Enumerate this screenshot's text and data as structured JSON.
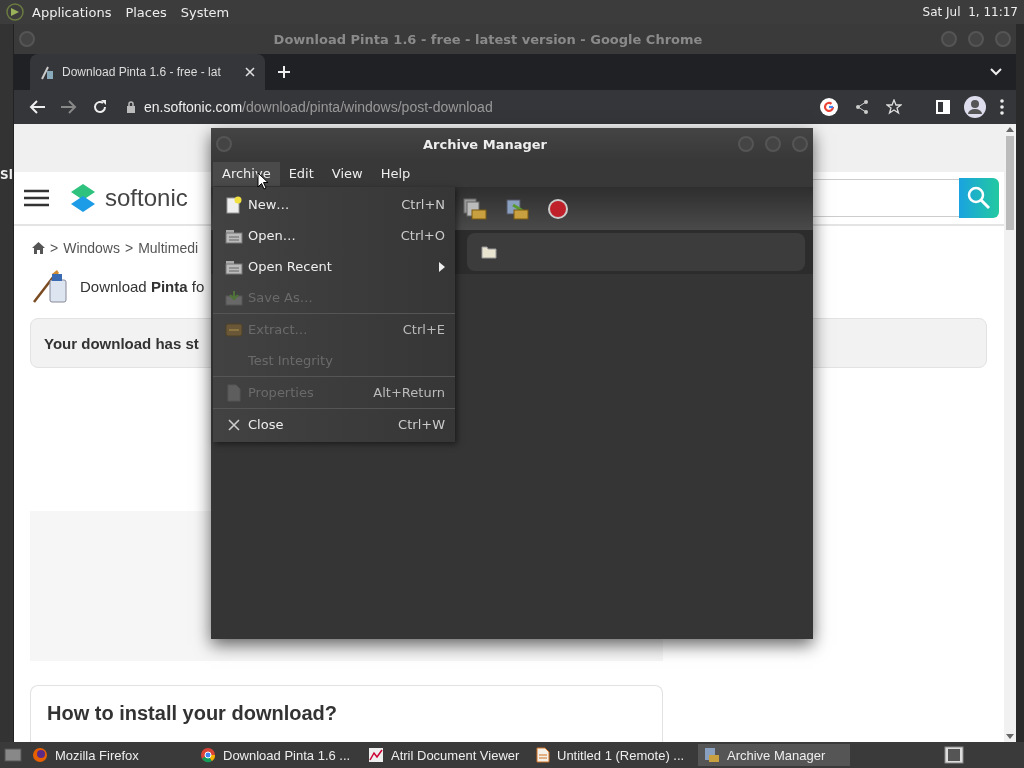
{
  "desktop_panel": {
    "menus": [
      "Applications",
      "Places",
      "System"
    ],
    "clock": "Sat Jul  1, 11:17"
  },
  "background_window": {
    "text": "Sl"
  },
  "browser": {
    "title": "Download Pinta 1.6 - free - latest version - Google Chrome",
    "tabs": [
      {
        "title": "Download Pinta 1.6 - free - lat",
        "selected": true
      }
    ],
    "url_host": "en.softonic.com",
    "url_path": "/download/pinta/windows/post-download"
  },
  "page": {
    "logo": "softonic",
    "breadcrumb": [
      {
        "sep": ">",
        "label": "Windows"
      },
      {
        "sep": ">",
        "label": "Multimedi"
      }
    ],
    "heading": "Download **Pinta** fo",
    "notice": "Your download has st",
    "install_title": "How to install your download?"
  },
  "archive_manager": {
    "title": "Archive Manager",
    "menus": [
      {
        "label": "Archive",
        "selected": true
      },
      {
        "label": "Edit",
        "selected": false
      },
      {
        "label": "View",
        "selected": false
      },
      {
        "label": "Help",
        "selected": false
      }
    ],
    "menu_items": [
      {
        "kind": "item",
        "label": "New…",
        "shortcut": "Ctrl+N",
        "disabled": false,
        "submenu": false
      },
      {
        "kind": "item",
        "label": "Open…",
        "shortcut": "Ctrl+O",
        "disabled": false,
        "submenu": false
      },
      {
        "kind": "item",
        "label": "Open Recent",
        "disabled": false,
        "submenu": true
      },
      {
        "kind": "item",
        "label": "Save As…",
        "disabled": true,
        "submenu": false
      },
      {
        "kind": "separator"
      },
      {
        "kind": "item",
        "label": "Extract…",
        "shortcut": "Ctrl+E",
        "disabled": true,
        "submenu": false
      },
      {
        "kind": "item",
        "label": "Test Integrity",
        "disabled": true,
        "submenu": false
      },
      {
        "kind": "separator"
      },
      {
        "kind": "item",
        "label": "Properties",
        "shortcut": "Alt+Return",
        "disabled": true,
        "submenu": false
      },
      {
        "kind": "separator"
      },
      {
        "kind": "item",
        "label": "Close",
        "shortcut": "Ctrl+W",
        "disabled": false,
        "submenu": false
      }
    ]
  },
  "taskbar": [
    {
      "label": "Mozilla Firefox",
      "selected": false
    },
    {
      "label": "Download Pinta 1.6 ...",
      "selected": false
    },
    {
      "label": "Atril Document Viewer",
      "selected": false
    },
    {
      "label": "Untitled 1 (Remote) ...",
      "selected": false
    },
    {
      "label": "Archive Manager",
      "selected": true
    }
  ]
}
